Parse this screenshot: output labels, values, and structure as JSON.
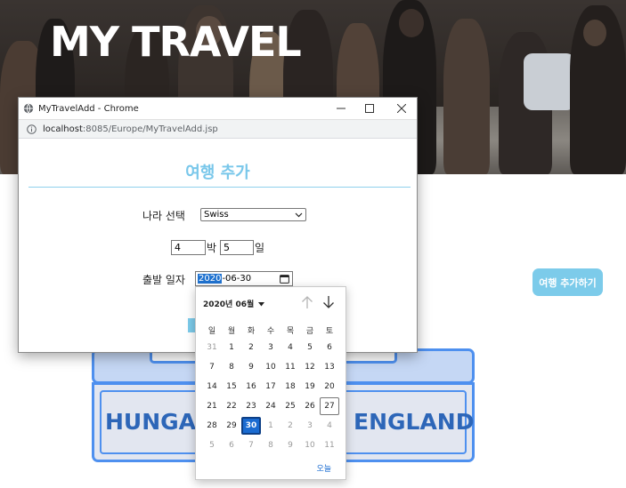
{
  "hero": {
    "title": "MY TRAVEL"
  },
  "page": {
    "add_trip_button": "여행 추가하기",
    "cards": [
      {
        "label": "HUNGAR"
      },
      {
        "label": "ENGLAND"
      }
    ]
  },
  "window": {
    "title": "MyTravelAdd - Chrome",
    "url_host": "localhost",
    "url_path": ":8085/Europe/MyTravelAdd.jsp",
    "icons": [
      "globe-icon",
      "minimize-icon",
      "maximize-icon",
      "close-icon",
      "info-icon"
    ]
  },
  "form": {
    "heading": "여행 추가",
    "country_label": "나라 선택",
    "country_value": "Swiss",
    "nights_value": "4",
    "nights_unit": "박",
    "days_value": "5",
    "days_unit": "일",
    "date_label": "출발 일자",
    "date_year": "2020",
    "date_rest": "-06-30"
  },
  "calendar": {
    "month_label": "2020년 06월",
    "weekdays": [
      "일",
      "월",
      "화",
      "수",
      "목",
      "금",
      "토"
    ],
    "weeks": [
      [
        "31",
        "1",
        "2",
        "3",
        "4",
        "5",
        "6"
      ],
      [
        "7",
        "8",
        "9",
        "10",
        "11",
        "12",
        "13"
      ],
      [
        "14",
        "15",
        "16",
        "17",
        "18",
        "19",
        "20"
      ],
      [
        "21",
        "22",
        "23",
        "24",
        "25",
        "26",
        "27"
      ],
      [
        "28",
        "29",
        "30",
        "1",
        "2",
        "3",
        "4"
      ],
      [
        "5",
        "6",
        "7",
        "8",
        "9",
        "10",
        "11"
      ]
    ],
    "today_link": "오늘",
    "colors": {
      "accent": "#1a6bd1",
      "heading": "#79c7ea",
      "button": "#7ccbea",
      "card_border": "#4e90ef"
    }
  }
}
